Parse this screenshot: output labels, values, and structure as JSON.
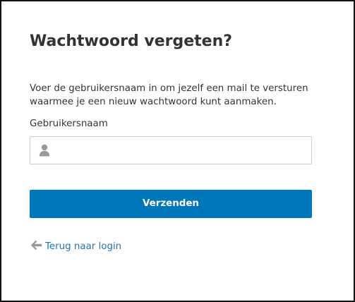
{
  "page": {
    "title": "Wachtwoord vergeten?",
    "description_line1": "Voer de gebruikersnaam in om jezelf een mail te versturen",
    "description_line2": "waarmee je een nieuw wachtwoord kunt aanmaken."
  },
  "form": {
    "username_label": "Gebruikersnaam",
    "username_value": "",
    "username_placeholder": "",
    "username_icon": "user-icon",
    "submit_label": "Verzenden"
  },
  "links": {
    "back_label": "Terug naar login",
    "back_icon": "arrow-left-icon"
  },
  "colors": {
    "primary": "#0077bb",
    "link": "#1f72b8",
    "text": "#333333",
    "icon": "#999999"
  }
}
